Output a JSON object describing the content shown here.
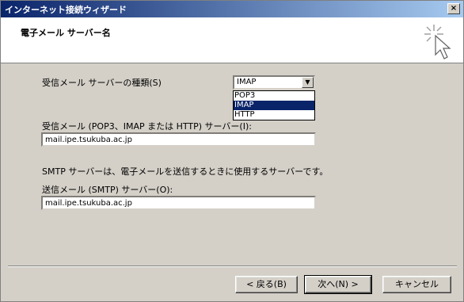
{
  "window": {
    "title": "インターネット接続ウィザード",
    "close_glyph": "×"
  },
  "header": {
    "title": "電子メール サーバー名",
    "icon": "wizard-sparkle-cursor-icon"
  },
  "form": {
    "incoming_type_label": "受信メール サーバーの種類(S)",
    "incoming_type_value": "IMAP",
    "incoming_type_options": [
      "POP3",
      "IMAP",
      "HTTP"
    ],
    "incoming_server_label": "受信メール (POP3、IMAP または HTTP) サーバー(I):",
    "incoming_server_value": "mail.ipe.tsukuba.ac.jp",
    "smtp_description": "SMTP サーバーは、電子メールを送信するときに使用するサーバーです。",
    "outgoing_server_label": "送信メール (SMTP) サーバー(O):",
    "outgoing_server_value": "mail.ipe.tsukuba.ac.jp"
  },
  "buttons": {
    "back": "< 戻る(B)",
    "next": "次へ(N) >",
    "cancel": "キャンセル"
  }
}
